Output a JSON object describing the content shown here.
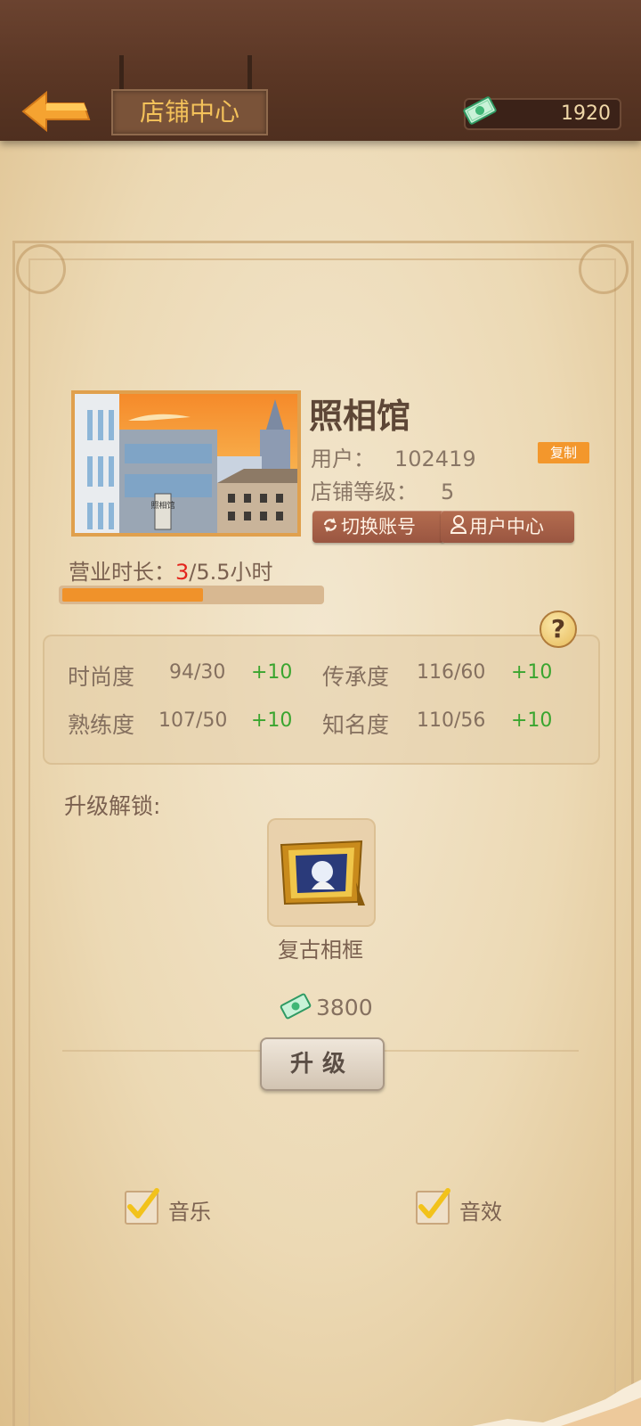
{
  "header": {
    "title": "店铺中心",
    "money": "1920",
    "back_icon": "back-arrow-icon",
    "money_icon": "cash-icon"
  },
  "shop": {
    "name": "照相馆",
    "user_label": "用户：",
    "user_id": "102419",
    "copy_label": "复制",
    "level_label": "店铺等级：",
    "level": "5",
    "switch_account_label": "切换账号",
    "user_center_label": "用户中心",
    "sign_text": "照相馆"
  },
  "business": {
    "label": "营业时长：",
    "current": "3",
    "total": "/5.5小时",
    "progress": 0.545
  },
  "stats": {
    "items": [
      {
        "label": "时尚度",
        "value": "94/30",
        "plus": "+10"
      },
      {
        "label": "传承度",
        "value": "116/60",
        "plus": "+10"
      },
      {
        "label": "熟练度",
        "value": "107/50",
        "plus": "+10"
      },
      {
        "label": "知名度",
        "value": "110/56",
        "plus": "+10"
      }
    ]
  },
  "unlock": {
    "label": "升级解锁:",
    "item_name": "复古相框",
    "price": "3800",
    "upgrade_label": "升级"
  },
  "settings": {
    "music_label": "音乐",
    "music_checked": true,
    "sound_label": "音效",
    "sound_checked": true
  },
  "colors": {
    "accent": "#f0922a",
    "plus": "#3aa52f",
    "highlight": "#e3241c"
  }
}
